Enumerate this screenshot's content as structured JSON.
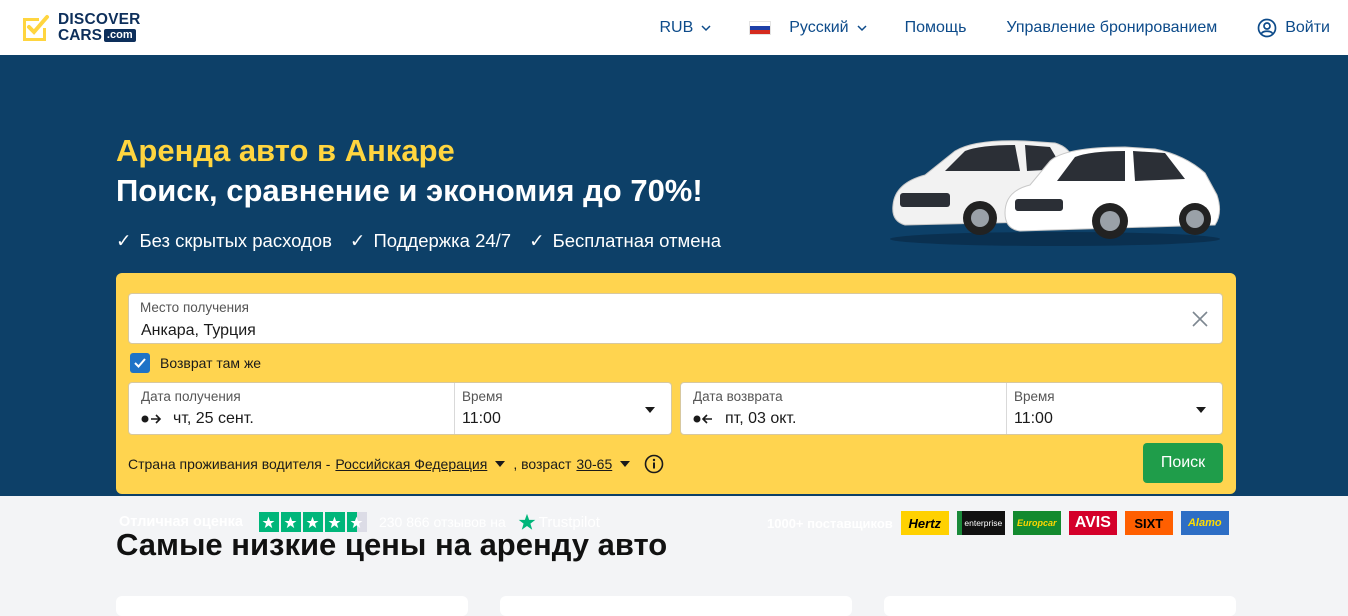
{
  "header": {
    "logo_line1": "DISCOVER",
    "logo_line2": "CARS",
    "logo_com": ".com",
    "currency": "RUB",
    "language": "Русский",
    "help": "Помощь",
    "manage_booking": "Управление бронированием",
    "login": "Войти"
  },
  "hero": {
    "title": "Аренда авто в Анкаре",
    "subtitle": "Поиск, сравнение и экономия до 70%!",
    "features": [
      "Без скрытых расходов",
      "Поддержка 24/7",
      "Бесплатная отмена"
    ]
  },
  "search": {
    "pickup_label": "Место получения",
    "pickup_value": "Анкара, Турция",
    "same_return_label": "Возврат там же",
    "same_return_checked": true,
    "pickup_date_label": "Дата получения",
    "pickup_date_value": "чт, 25 сент.",
    "pickup_time_label": "Время",
    "pickup_time_value": "11:00",
    "return_date_label": "Дата возврата",
    "return_date_value": "пт, 03 окт.",
    "return_time_label": "Время",
    "return_time_value": "11:00",
    "residence_text": "Страна проживания водителя -",
    "residence_value": "Российская Федерация",
    "age_text": ", возраст",
    "age_value": "30-65",
    "search_button": "Поиск"
  },
  "trust": {
    "rating_label": "Отличная оценка",
    "stars": 4.5,
    "reviews_text": "230 866 отзывов на",
    "trustpilot": "Trustpilot",
    "providers_label": "1000+ поставщиков",
    "providers": [
      "Hertz",
      "enterprise",
      "Europcar",
      "AVIS",
      "SIXT",
      "Alamo"
    ]
  },
  "section": {
    "title": "Самые низкие цены на аренду авто"
  },
  "colors": {
    "hero_bg": "#0d4068",
    "accent_yellow": "#ffd44f",
    "title_yellow": "#ffd53f",
    "search_button": "#1f9d4a",
    "link_blue": "#0d4b8a"
  }
}
